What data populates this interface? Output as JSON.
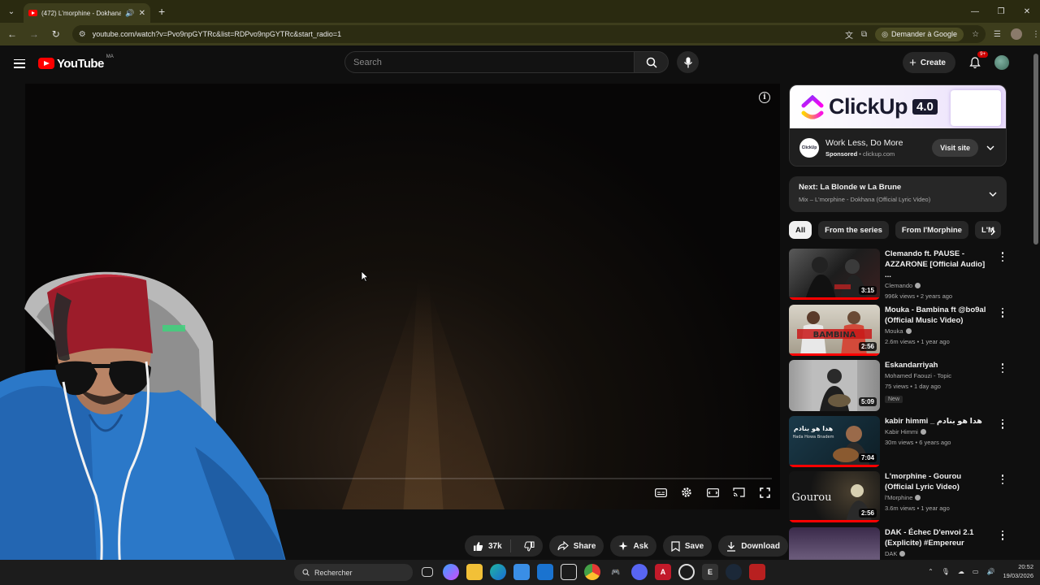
{
  "browser": {
    "tab_title": "(472) L'morphine - Dokhana",
    "url": "youtube.com/watch?v=Pvo9npGYTRc&list=RDPvo9npGYTRc&start_radio=1",
    "google_button": "Demander à Google"
  },
  "header": {
    "logo_text": "YouTube",
    "country": "MA",
    "search_placeholder": "Search",
    "create_label": "Create",
    "notif_badge": "9+"
  },
  "actions": {
    "like_count": "37k",
    "share": "Share",
    "ask": "Ask",
    "save": "Save",
    "download": "Download"
  },
  "ad": {
    "brand": "ClickUp",
    "version": "4.0",
    "title": "Work Less, Do More",
    "sponsored": "Sponsored",
    "domain": "clickup.com",
    "visit": "Visit site",
    "icon_text": "ClickUp"
  },
  "next": {
    "title": "Next: La Blonde w La Brune",
    "subtitle": "Mix – L'morphine - Dokhana (Official Lyric Video)"
  },
  "chips": [
    "All",
    "From the series",
    "From l'Morphine",
    "L'M"
  ],
  "recs": [
    {
      "title": "Clemando ft. PAUSE - AZZARONE [Official Audio] ...",
      "channel": "Clemando",
      "verified": true,
      "stats": "996k views • 2 years ago",
      "duration": "3:15",
      "new": ""
    },
    {
      "title": "Mouka - Bambina ft @bo9al (Official Music Video)",
      "channel": "Mouka",
      "verified": true,
      "stats": "2.6m views • 1 year ago",
      "duration": "2:56",
      "new": ""
    },
    {
      "title": "Eskandarriyah",
      "channel": "Mohamed Faouzi - Topic",
      "verified": false,
      "stats": "75 views • 1 day ago",
      "duration": "5:09",
      "new": "New"
    },
    {
      "title": "kabir himmi _ هدا هو بنادم",
      "channel": "Kabir Himmi",
      "verified": true,
      "stats": "30m views • 6 years ago",
      "duration": "7:04",
      "new": ""
    },
    {
      "title": "L'morphine - Gourou (Official Lyric Video)",
      "channel": "l'Morphine",
      "verified": true,
      "stats": "3.6m views • 1 year ago",
      "duration": "2:56",
      "new": ""
    },
    {
      "title": "DAK - Échec D'envoi 2.1 (Explicite) #Empereur",
      "channel": "DAK",
      "verified": true,
      "stats": "",
      "duration": "",
      "new": ""
    }
  ],
  "taskbar": {
    "search": "Rechercher",
    "time": "20:52",
    "date": "19/03/2026"
  }
}
